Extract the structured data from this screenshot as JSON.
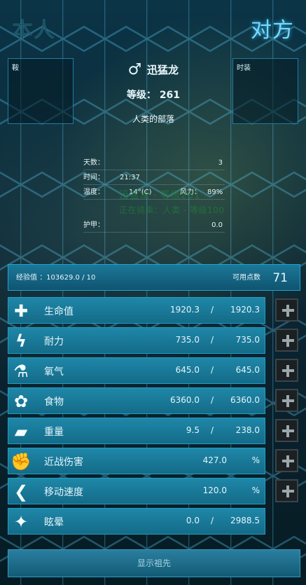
{
  "tabs": {
    "self": "本人",
    "enemy": "对方"
  },
  "slots": {
    "left": "鞍",
    "right": "时装"
  },
  "creature": {
    "name": "迅猛龙",
    "level_label": "等级：",
    "level": "261",
    "tribe": "人类的部落"
  },
  "info": {
    "days_label": "天数：",
    "days": "3",
    "time_label": "时间：",
    "time": "21:37",
    "temperature_label": "温度：",
    "temperature": "14°(C)",
    "wind_label": "风力：",
    "wind": "89%",
    "armor_label": "护甲：",
    "armor": "0.0"
  },
  "overlay_text": {
    "line1": "迅猛龙 - 等级261",
    "line2": "正在骑乘：人类 - 等级100"
  },
  "experience": {
    "label": "经验值",
    "value": "：103629.0 / 10",
    "points_label": "可用点数",
    "points": "71"
  },
  "stats": [
    {
      "icon": "health-cross-icon",
      "label": "生命值",
      "current": "1920.3",
      "max": "1920.3"
    },
    {
      "icon": "stamina-lightning-icon",
      "label": "耐力",
      "current": "735.0",
      "max": "735.0"
    },
    {
      "icon": "oxygen-tank-icon",
      "label": "氧气",
      "current": "645.0",
      "max": "645.0"
    },
    {
      "icon": "food-bag-icon",
      "label": "食物",
      "current": "6360.0",
      "max": "6360.0"
    },
    {
      "icon": "weight-icon",
      "label": "重量",
      "current": "9.5",
      "max": "238.0"
    },
    {
      "icon": "melee-fist-icon",
      "label": "近战伤害",
      "current": "427.0",
      "unit": "%"
    },
    {
      "icon": "movement-speed-icon",
      "label": "移动速度",
      "current": "120.0",
      "unit": "%"
    },
    {
      "icon": "torpor-stars-icon",
      "label": "眩晕",
      "current": "0.0",
      "max": "2988.5"
    }
  ],
  "bottom_button": "显示祖先"
}
